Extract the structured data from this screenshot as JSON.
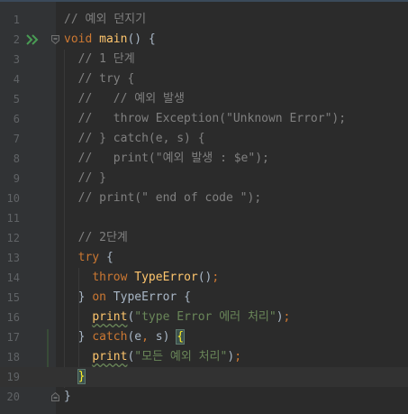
{
  "colors": {
    "background": "#2b2b2b",
    "gutter": "#313335",
    "comment": "#808080",
    "keyword": "#cc7832",
    "function": "#ffc66d",
    "string": "#6a8759",
    "plain": "#a9b7c6",
    "line_number": "#606366",
    "run_icon": "#499c54"
  },
  "icons": {
    "run": "run-icon",
    "fold": "fold-icon"
  },
  "lines": [
    {
      "num": "1",
      "tokens": [
        {
          "t": "// 예외 던지기",
          "c": "cm"
        }
      ]
    },
    {
      "num": "2",
      "tokens": [
        {
          "t": "void ",
          "c": "kw"
        },
        {
          "t": "main",
          "c": "fn"
        },
        {
          "t": "() {",
          "c": "pl"
        }
      ]
    },
    {
      "num": "3",
      "tokens": [
        {
          "t": "  // 1 단계",
          "c": "cm"
        }
      ]
    },
    {
      "num": "4",
      "tokens": [
        {
          "t": "  // try {",
          "c": "cm"
        }
      ]
    },
    {
      "num": "5",
      "tokens": [
        {
          "t": "  //   // 예외 발생",
          "c": "cm"
        }
      ]
    },
    {
      "num": "6",
      "tokens": [
        {
          "t": "  //   throw Exception(\"Unknown Error\");",
          "c": "cm"
        }
      ]
    },
    {
      "num": "7",
      "tokens": [
        {
          "t": "  // } catch(e, s) {",
          "c": "cm"
        }
      ]
    },
    {
      "num": "8",
      "tokens": [
        {
          "t": "  //   print(\"예외 발생 : $e\");",
          "c": "cm"
        }
      ]
    },
    {
      "num": "9",
      "tokens": [
        {
          "t": "  // }",
          "c": "cm"
        }
      ]
    },
    {
      "num": "10",
      "tokens": [
        {
          "t": "  // print(\" end of code \");",
          "c": "cm"
        }
      ]
    },
    {
      "num": "11",
      "tokens": []
    },
    {
      "num": "12",
      "tokens": [
        {
          "t": "  // 2단계",
          "c": "cm"
        }
      ]
    },
    {
      "num": "13",
      "tokens": [
        {
          "t": "  ",
          "c": "pl"
        },
        {
          "t": "try",
          "c": "kw"
        },
        {
          "t": " {",
          "c": "pl"
        }
      ]
    },
    {
      "num": "14",
      "tokens": [
        {
          "t": "    ",
          "c": "pl"
        },
        {
          "t": "throw ",
          "c": "kw"
        },
        {
          "t": "TypeError",
          "c": "ty"
        },
        {
          "t": "()",
          "c": "pl"
        },
        {
          "t": ";",
          "c": "kw"
        }
      ]
    },
    {
      "num": "15",
      "tokens": [
        {
          "t": "  } ",
          "c": "pl"
        },
        {
          "t": "on ",
          "c": "kw"
        },
        {
          "t": "TypeError",
          "c": "pl"
        },
        {
          "t": " {",
          "c": "pl"
        }
      ]
    },
    {
      "num": "16",
      "tokens": [
        {
          "t": "    ",
          "c": "pl"
        },
        {
          "t": "print",
          "c": "fn squig"
        },
        {
          "t": "(",
          "c": "pl"
        },
        {
          "t": "\"type Error 에러 처리\"",
          "c": "str"
        },
        {
          "t": ")",
          "c": "pl"
        },
        {
          "t": ";",
          "c": "kw"
        }
      ]
    },
    {
      "num": "17",
      "tokens": [
        {
          "t": "  } ",
          "c": "pl"
        },
        {
          "t": "catch",
          "c": "kw"
        },
        {
          "t": "(e",
          "c": "pl"
        },
        {
          "t": ", ",
          "c": "kw"
        },
        {
          "t": "s) ",
          "c": "pl"
        },
        {
          "t": "{",
          "c": "brace-match"
        }
      ]
    },
    {
      "num": "18",
      "tokens": [
        {
          "t": "    ",
          "c": "pl"
        },
        {
          "t": "print",
          "c": "fn squig"
        },
        {
          "t": "(",
          "c": "pl"
        },
        {
          "t": "\"모든 예외 처리\"",
          "c": "str"
        },
        {
          "t": ")",
          "c": "pl"
        },
        {
          "t": ";",
          "c": "kw"
        }
      ]
    },
    {
      "num": "19",
      "tokens": [
        {
          "t": "  ",
          "c": "pl"
        },
        {
          "t": "}",
          "c": "brace-match"
        }
      ]
    },
    {
      "num": "20",
      "tokens": [
        {
          "t": "}",
          "c": "pl"
        }
      ]
    }
  ]
}
